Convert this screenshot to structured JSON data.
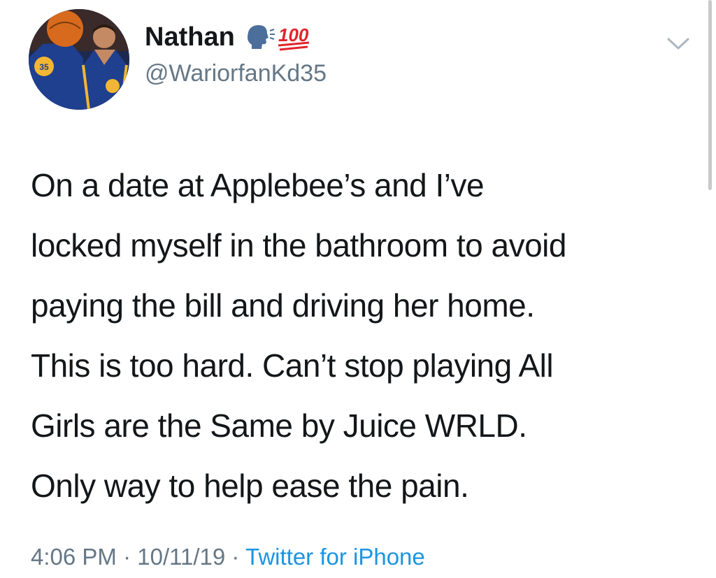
{
  "user": {
    "display_name": "Nathan",
    "handle": "@WariorfanKd35",
    "badge_icons": [
      "speaking-head-icon",
      "hundred-points-icon"
    ],
    "hundred_text": "100"
  },
  "tweet": {
    "lines": [
      "On a date at Applebee’s and I’ve",
      "locked myself in the bathroom to avoid",
      "paying the bill and driving her home.",
      "This is too hard. Can’t stop playing All",
      "Girls are the Same by Juice WRLD.",
      "Only way to help ease the pain."
    ]
  },
  "meta": {
    "time": "4:06 PM",
    "separator": " · ",
    "date": "10/11/19",
    "source": "Twitter for iPhone"
  },
  "colors": {
    "text": "#14171a",
    "secondary": "#657786",
    "link": "#1b95e0",
    "emoji_red": "#e0242c",
    "emoji_blue": "#4b6e9b"
  }
}
